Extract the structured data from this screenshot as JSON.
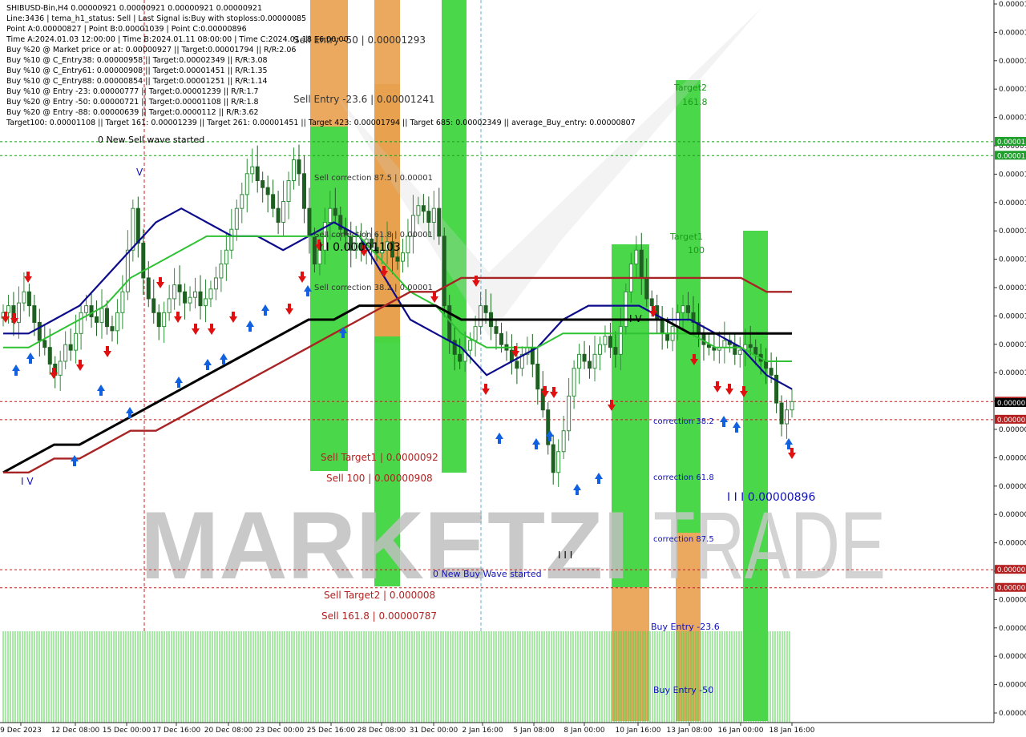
{
  "colors": {
    "background": "#ffffff",
    "candle_up": "#2f8f3a",
    "candle_down": "#1f5f22",
    "ma_fast": "#0b0b8c",
    "ma_mid": "#2fc232",
    "ma_slow": "#000000",
    "ma_slowest": "#a82424",
    "zone_green": "#40d640",
    "zone_orange": "#e8a04c",
    "sell_level": "#b22222",
    "target_level": "#1a9a1a",
    "blue_text": "#1010c0",
    "watermark": "#bfbfbf",
    "volume_green": "#4cd44c",
    "price_tag_green": "#1e9e2a",
    "price_tag_red": "#b42020",
    "price_tag_black": "#000000"
  },
  "info_lines": [
    "SHIBUSD-Bin,H4  0.00000921 0.00000921 0.00000921 0.00000921",
    "Line:3436 | tema_h1_status: Sell | Last Signal is:Buy with stoploss:0.00000085",
    "Point A:0.00000827 | Point B:0.00001039 | Point C:0.00000896",
    "Time A:2024.01.03 12:00:00 | Time B:2024.01.11 08:00:00 | Time C:2024.01.18 16:00:00",
    "Buy %20 @ Market price or at: 0.00000927 || Target:0.00001794 || R/R:2.06",
    "Buy %10 @ C_Entry38: 0.00000958 || Target:0.00002349 || R/R:3.08",
    "Buy %10 @ C_Entry61: 0.00000908 || Target:0.00001451 || R/R:1.35",
    "Buy %10 @ C_Entry88: 0.00000854 || Target:0.00001251 || R/R:1.14",
    "Buy %10 @ Entry -23: 0.00000777 || Target:0.00001239 || R/R:1.7",
    "Buy %20 @ Entry -50: 0.00000721 || Target:0.00001108 || R/R:1.8",
    "Buy %20 @ Entry -88: 0.00000639 || Target:0.0000112 || R/R:3.62",
    "Target100: 0.00001108 || Target 161: 0.00001239 || Target 261: 0.00001451 || Target 423: 0.00001794 || Target 685: 0.00002349 || average_Buy_entry: 0.00000807"
  ],
  "watermark": {
    "left": "MARKETZI",
    "right": "TRADE"
  },
  "chart_labels": [
    {
      "text": "0 New Sell wave started",
      "color": "#000000"
    },
    {
      "text": "Sell Entry -50 | 0.00001293",
      "color": "#333333"
    },
    {
      "text": "Sell Entry -23.6 | 0.00001241",
      "color": "#333333"
    },
    {
      "text": "Sell correction 87.5 | 0.00001",
      "color": "#333333"
    },
    {
      "text": "Sell correction 61.8 | 0.00001",
      "color": "#333333"
    },
    {
      "text": "Sell correction 38.2 | 0.00001",
      "color": "#333333"
    },
    {
      "text": "I I 0.00001103",
      "color": "#000000"
    },
    {
      "text": "Target2",
      "color": "#1a9a1a"
    },
    {
      "text": "161.8",
      "color": "#1a9a1a"
    },
    {
      "text": "Target1",
      "color": "#1a9a1a"
    },
    {
      "text": "100",
      "color": "#1a9a1a"
    },
    {
      "text": "correction 38.2",
      "color": "#1010c0"
    },
    {
      "text": "correction 61.8",
      "color": "#1010c0"
    },
    {
      "text": "correction 87.5",
      "color": "#1010c0"
    },
    {
      "text": "I I I 0.00000896",
      "color": "#1010c0"
    },
    {
      "text": "Sell Target1 | 0.0000092",
      "color": "#b22222"
    },
    {
      "text": "Sell 100 | 0.00000908",
      "color": "#b22222"
    },
    {
      "text": "Sell Target2 | 0.000008",
      "color": "#b22222"
    },
    {
      "text": "Sell 161.8 | 0.00000787",
      "color": "#b22222"
    },
    {
      "text": "0 New Buy Wave started",
      "color": "#1010c0"
    },
    {
      "text": "Buy Entry -23.6",
      "color": "#1010c0"
    },
    {
      "text": "Buy Entry -50",
      "color": "#1010c0"
    },
    {
      "text": "I V",
      "color": "#1010c0"
    },
    {
      "text": "V",
      "color": "#1010c0"
    },
    {
      "text": "I V",
      "color": "#000000"
    },
    {
      "text": "I I I",
      "color": "#000000"
    }
  ],
  "price_axis_label": "0.00000",
  "price_tags": [
    {
      "text": "0.00001",
      "color": "#1e9e2a"
    },
    {
      "text": "0.00001",
      "color": "#1e9e2a"
    },
    {
      "text": "0.00001",
      "color": "#1e9e2a"
    },
    {
      "text": "0.00001",
      "color": "#1e9e2a"
    },
    {
      "text": "0.00000",
      "color": "#b42020"
    },
    {
      "text": "0.00000",
      "color": "#000000"
    },
    {
      "text": "0.00000",
      "color": "#b42020"
    },
    {
      "text": "0.00000",
      "color": "#b42020"
    },
    {
      "text": "0.00000",
      "color": "#b42020"
    }
  ],
  "chart_data": {
    "type": "candlestick",
    "symbol": "SHIBUSD-Bin",
    "timeframe": "H4",
    "x_tick_labels": [
      "9 Dec 2023",
      "12 Dec 08:00",
      "15 Dec 00:00",
      "17 Dec 16:00",
      "20 Dec 08:00",
      "23 Dec 00:00",
      "25 Dec 16:00",
      "28 Dec 08:00",
      "31 Dec 00:00",
      "2 Jan 16:00",
      "5 Jan 08:00",
      "8 Jan 00:00",
      "10 Jan 16:00",
      "13 Jan 08:00",
      "16 Jan 00:00",
      "18 Jan 16:00"
    ],
    "close_series": [
      9.85e-06,
      9.9e-06,
      9.78e-06,
      9.92e-06,
      1e-05,
      9.9e-06,
      9.78e-06,
      9.65e-06,
      9.6e-06,
      9.48e-06,
      9.4e-06,
      9.5e-06,
      9.62e-06,
      9.58e-06,
      9.7e-06,
      9.85e-06,
      9.9e-06,
      9.82e-06,
      9.78e-06,
      9.88e-06,
      9.75e-06,
      9.72e-06,
      9.85e-06,
      1e-05,
      1.03e-05,
      1.06e-05,
      1.035e-05,
      1.01e-05,
      9.95e-06,
      9.85e-06,
      9.75e-06,
      9.85e-06,
      9.95e-06,
      1.005e-05,
      1e-05,
      9.92e-06,
      9.96e-06,
      1e-05,
      9.9e-06,
      9.95e-06,
      1.002e-05,
      1.01e-05,
      1.02e-05,
      1.03e-05,
      1.045e-05,
      1.06e-05,
      1.07e-05,
      1.085e-05,
      1.09e-05,
      1.08e-05,
      1.075e-05,
      1.07e-05,
      1.06e-05,
      1.05e-05,
      1.065e-05,
      1.08e-05,
      1.095e-05,
      1.085e-05,
      1.06e-05,
      1.04e-05,
      1.02e-05,
      1.03e-05,
      1.05e-05,
      1.06e-05,
      1.055e-05,
      1.045e-05,
      1.04e-05,
      1.03e-05,
      1.035e-05,
      1.03e-05,
      1.038e-05,
      1.032e-05,
      1.028e-05,
      1.03e-05,
      1.036e-05,
      1.025e-05,
      1.022e-05,
      1.028e-05,
      1.04e-05,
      1.055e-05,
      1.062e-05,
      1.058e-05,
      1.05e-05,
      1.06e-05,
      1.04e-05,
      9.9e-06,
      9.65e-06,
      9.55e-06,
      9.5e-06,
      9.58e-06,
      9.65e-06,
      9.75e-06,
      9.9e-06,
      9.85e-06,
      9.75e-06,
      9.7e-06,
      9.62e-06,
      9.58e-06,
      9.5e-06,
      9.45e-06,
      9.55e-06,
      9.6e-06,
      9.48e-06,
      9.3e-06,
      9.15e-06,
      8.9e-06,
      8.7e-06,
      8.85e-06,
      9e-06,
      9.25e-06,
      9.45e-06,
      9.55e-06,
      9.5e-06,
      9.45e-06,
      9.55e-06,
      9.62e-06,
      9.68e-06,
      9.6e-06,
      9.55e-06,
      9.75e-06,
      1e-05,
      1.02e-05,
      1.03e-05,
      1.01e-05,
      9.95e-06,
      9.9e-06,
      9.8e-06,
      9.7e-06,
      9.65e-06,
      9.75e-06,
      9.85e-06,
      9.9e-06,
      9.85e-06,
      9.78e-06,
      9.7e-06,
      9.62e-06,
      9.6e-06,
      9.58e-06,
      9.6e-06,
      9.65e-06,
      9.62e-06,
      9.55e-06,
      9.58e-06,
      9.62e-06,
      9.6e-06,
      9.55e-06,
      9.5e-06,
      9.45e-06,
      9.4e-06,
      9.2e-06,
      9.05e-06,
      9.15e-06,
      9.21e-06
    ],
    "ylim": [
      6.9e-06,
      1.21e-05
    ],
    "y_axis_ticks": [
      "0.00001",
      "0.00001",
      "0.00001",
      "0.00001",
      "0.00001",
      "0.00001",
      "0.00001",
      "0.00001",
      "0.00001",
      "0.00001",
      "0.00001",
      "0.00001",
      "0.00001",
      "0.00001",
      "0.00000",
      "0.00000",
      "0.00000",
      "0.00000",
      "0.00000",
      "0.00000",
      "0.00000",
      "0.00000",
      "0.00000",
      "0.00000",
      "0.00000",
      "0.00000"
    ],
    "moving_averages": [
      {
        "values": [
          9.7e-06,
          9.7e-06,
          9.8e-06,
          9.9e-06,
          1.01e-05,
          1.03e-05,
          1.05e-05,
          1.06e-05,
          1.05e-05,
          1.04e-05,
          1.04e-05,
          1.03e-05,
          1.04e-05,
          1.05e-05,
          1.04e-05,
          1.01e-05,
          9.8e-06,
          9.7e-06,
          9.6e-06,
          9.4e-06,
          9.5e-06,
          9.6e-06,
          9.8e-06,
          9.9e-06,
          9.9e-06,
          9.9e-06,
          9.8e-06,
          9.8e-06,
          9.7e-06,
          9.6e-06,
          9.4e-06,
          9.3e-06
        ]
      },
      {
        "values": [
          9.6e-06,
          9.6e-06,
          9.7e-06,
          9.8e-06,
          9.9e-06,
          1.01e-05,
          1.02e-05,
          1.03e-05,
          1.04e-05,
          1.04e-05,
          1.04e-05,
          1.04e-05,
          1.04e-05,
          1.04e-05,
          1.04e-05,
          1.02e-05,
          1e-05,
          9.9e-06,
          9.7e-06,
          9.6e-06,
          9.6e-06,
          9.6e-06,
          9.7e-06,
          9.7e-06,
          9.7e-06,
          9.7e-06,
          9.7e-06,
          9.7e-06,
          9.6e-06,
          9.6e-06,
          9.5e-06,
          9.5e-06
        ]
      },
      {
        "values": [
          8.7e-06,
          8.8e-06,
          8.9e-06,
          8.9e-06,
          9e-06,
          9.1e-06,
          9.2e-06,
          9.3e-06,
          9.4e-06,
          9.5e-06,
          9.6e-06,
          9.7e-06,
          9.8e-06,
          9.8e-06,
          9.9e-06,
          9.9e-06,
          9.9e-06,
          9.9e-06,
          9.8e-06,
          9.8e-06,
          9.8e-06,
          9.8e-06,
          9.8e-06,
          9.8e-06,
          9.8e-06,
          9.8e-06,
          9.8e-06,
          9.7e-06,
          9.7e-06,
          9.7e-06,
          9.7e-06,
          9.7e-06
        ]
      },
      {
        "values": [
          8.7e-06,
          8.7e-06,
          8.8e-06,
          8.8e-06,
          8.9e-06,
          9e-06,
          9e-06,
          9.1e-06,
          9.2e-06,
          9.3e-06,
          9.4e-06,
          9.5e-06,
          9.6e-06,
          9.7e-06,
          9.8e-06,
          9.9e-06,
          1e-05,
          1e-05,
          1.01e-05,
          1.01e-05,
          1.01e-05,
          1.01e-05,
          1.01e-05,
          1.01e-05,
          1.01e-05,
          1.01e-05,
          1.01e-05,
          1.01e-05,
          1.01e-05,
          1.01e-05,
          1e-05,
          1e-05
        ]
      }
    ],
    "horizontal_levels": [
      {
        "price": 1.239e-05,
        "style": "dashed",
        "color": "#1a9a1a"
      },
      {
        "price": 1.22e-05,
        "style": "dashed",
        "color": "#1a9a1a"
      },
      {
        "price": 1.108e-05,
        "style": "dashed",
        "color": "#1a9a1a"
      },
      {
        "price": 1.098e-05,
        "style": "dashed",
        "color": "#1a9a1a"
      },
      {
        "price": 9.21e-06,
        "style": "dashed",
        "color": "#b22222"
      },
      {
        "price": 9.08e-06,
        "style": "dashed",
        "color": "#b22222"
      },
      {
        "price": 8e-06,
        "style": "dashed",
        "color": "#b22222"
      },
      {
        "price": 7.87e-06,
        "style": "dashed",
        "color": "#b22222"
      }
    ]
  }
}
